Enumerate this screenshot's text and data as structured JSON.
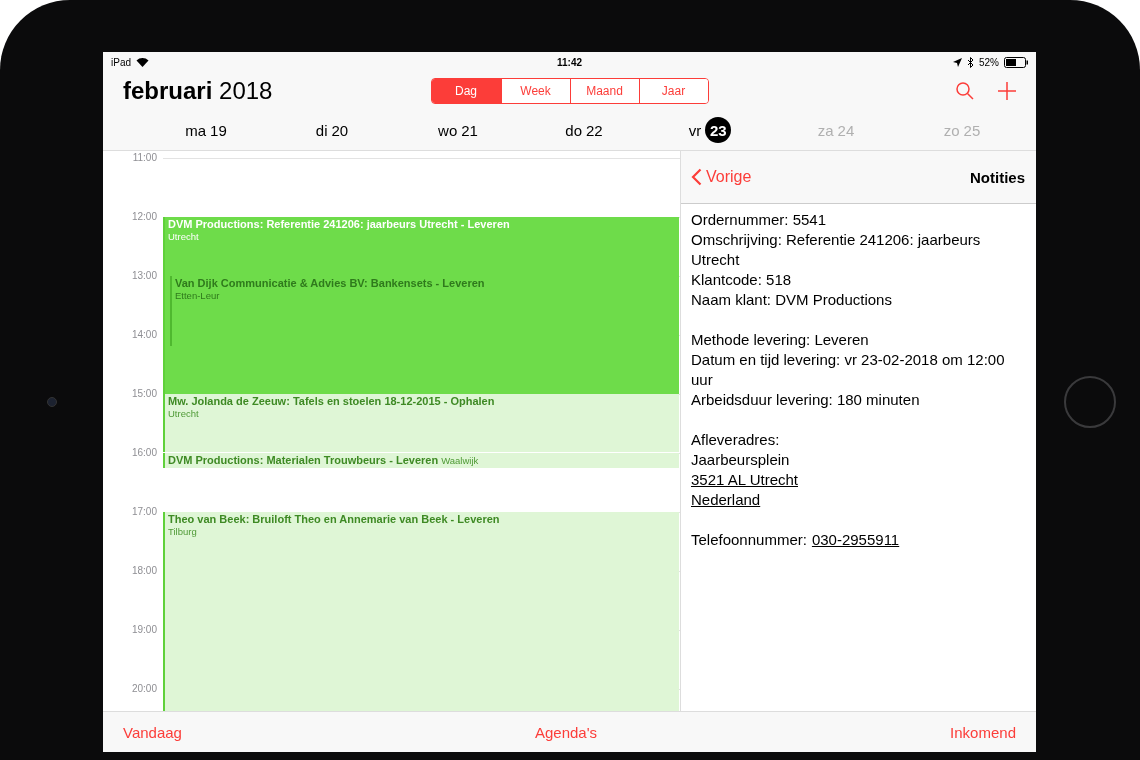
{
  "status_bar": {
    "device": "iPad",
    "time": "11:42",
    "battery": "52%"
  },
  "header": {
    "title": "**februari** 2018",
    "segments": [
      {
        "label": "Dag",
        "selected": true
      },
      {
        "label": "Week",
        "selected": false
      },
      {
        "label": "Maand",
        "selected": false
      },
      {
        "label": "Jaar",
        "selected": false
      }
    ]
  },
  "days": [
    {
      "name": "ma",
      "number": "19",
      "selected": false,
      "dimmed": false
    },
    {
      "name": "di",
      "number": "20",
      "selected": false,
      "dimmed": false
    },
    {
      "name": "wo",
      "number": "21",
      "selected": false,
      "dimmed": false
    },
    {
      "name": "do",
      "number": "22",
      "selected": false,
      "dimmed": false
    },
    {
      "name": "vr",
      "number": "23",
      "selected": true,
      "dimmed": false
    },
    {
      "name": "za",
      "number": "24",
      "selected": false,
      "dimmed": true
    },
    {
      "name": "zo",
      "number": "25",
      "selected": false,
      "dimmed": true
    }
  ],
  "hours": [
    "11:00",
    "12:00",
    "13:00",
    "14:00",
    "15:00",
    "16:00",
    "17:00",
    "18:00",
    "19:00",
    "20:00"
  ],
  "events": [
    {
      "kind": "block",
      "title": "DVM Productions: Referentie 241206: jaarbeurs Utrecht - Leveren",
      "location": "Utrecht",
      "selected": true
    },
    {
      "kind": "behind",
      "title": "Van Dijk Communicatie & Advies BV: Bankensets - Leveren",
      "location": "Etten-Leur",
      "selected": false
    },
    {
      "kind": "block",
      "title": "Mw. Jolanda de Zeeuw: Tafels en stoelen 18-12-2015 - Ophalen",
      "location": "Utrecht",
      "selected": false
    },
    {
      "kind": "inline",
      "title": "DVM Productions: Materialen Trouwbeurs - Leveren",
      "location": "Waalwijk",
      "selected": false
    },
    {
      "kind": "block",
      "title": "Theo van Beek: Bruiloft Theo en Annemarie van Beek - Leveren",
      "location": "Tilburg",
      "selected": false
    }
  ],
  "detail": {
    "back": "Vorige",
    "title": "Notities",
    "notes": [
      [
        {
          "text": "Ordernummer: 5541"
        },
        {
          "text": "Omschrijving: Referentie 241206: jaarbeurs Utrecht"
        },
        {
          "text": "Klantcode: 518"
        },
        {
          "text": "Naam klant: DVM Productions"
        }
      ],
      [
        {
          "text": "Methode levering: Leveren"
        },
        {
          "text": "Datum en tijd levering: vr 23-02-2018 om 12:00 uur"
        },
        {
          "text": "Arbeidsduur levering: 180 minuten"
        }
      ],
      [
        {
          "text": "Afleveradres:"
        },
        {
          "text": "Jaarbeursplein"
        },
        {
          "link": "3521 AL Utrecht"
        },
        {
          "link": "Nederland"
        }
      ],
      [
        {
          "text": "Telefoonnummer:",
          "link": "030-2955911"
        }
      ]
    ]
  },
  "toolbar": [
    "Vandaag",
    "Agenda's",
    "Inkomend"
  ]
}
